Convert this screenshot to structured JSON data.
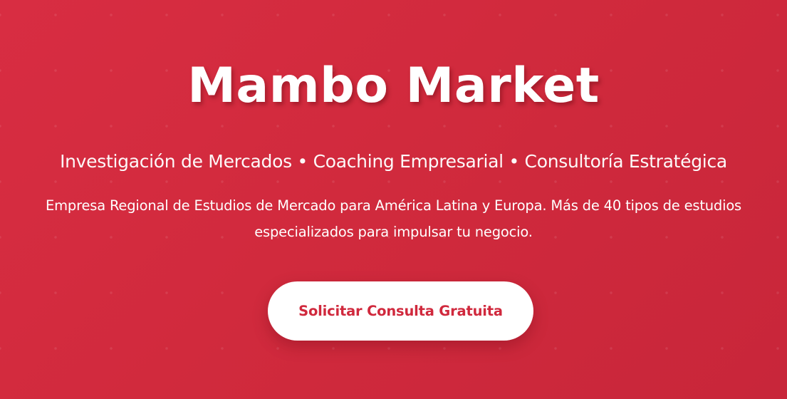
{
  "hero": {
    "title": "Mambo Market",
    "subtitle": "Investigación de Mercados • Coaching Empresarial • Consultoría Estratégica",
    "description": "Empresa Regional de Estudios de Mercado para América Latina y Europa. Más de 40 tipos de estudios especializados para impulsar tu negocio.",
    "cta_label": "Solicitar Consulta Gratuita"
  },
  "colors": {
    "background": "#d12a3d",
    "button_background": "#ffffff",
    "button_text": "#d0293d",
    "text": "#ffffff"
  }
}
